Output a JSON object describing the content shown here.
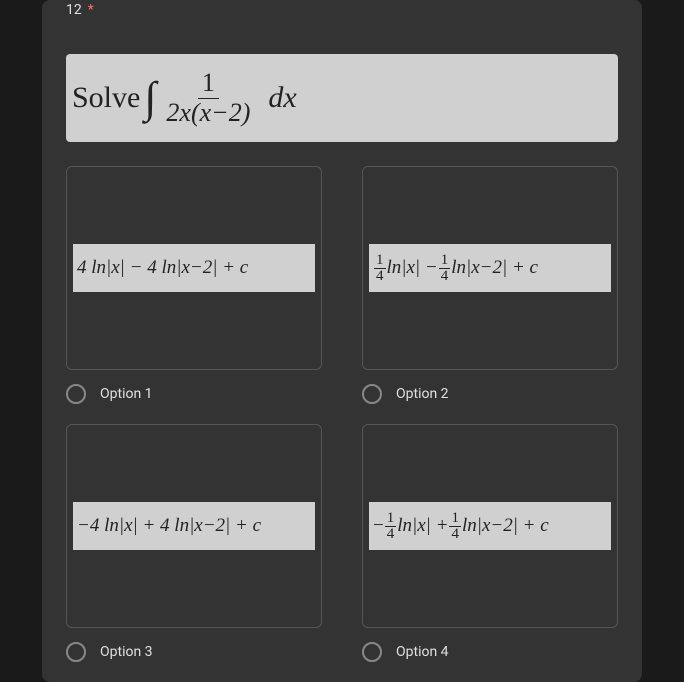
{
  "question": {
    "number": "12",
    "required_marker": "*",
    "prompt_prefix": "Solve",
    "integral": {
      "numerator": "1",
      "denominator": "2x(x−2)",
      "suffix": "dx"
    }
  },
  "options": [
    {
      "label": "Option 1",
      "formula_plain": "4 ln|x| − 4 ln|x−2| + c"
    },
    {
      "label": "Option 2",
      "formula_frac": {
        "a_sign": "",
        "a_num": "1",
        "a_den": "4",
        "mid": "ln|x| −",
        "b_num": "1",
        "b_den": "4",
        "tail": "ln|x−2| + c"
      }
    },
    {
      "label": "Option 3",
      "formula_plain": "−4 ln|x| + 4 ln|x−2| + c"
    },
    {
      "label": "Option 4",
      "formula_frac": {
        "a_sign": "−",
        "a_num": "1",
        "a_den": "4",
        "mid": "ln|x| +",
        "b_num": "1",
        "b_den": "4",
        "tail": "ln|x−2| + c"
      }
    }
  ],
  "chart_data": {
    "type": "table",
    "title": "Multiple choice integral question",
    "question": "Solve ∫ 1 / (2x(x−2)) dx",
    "choices": [
      "4 ln|x| − 4 ln|x−2| + c",
      "(1/4) ln|x| − (1/4) ln|x−2| + c",
      "−4 ln|x| + 4 ln|x−2| + c",
      "−(1/4) ln|x| + (1/4) ln|x−2| + c"
    ]
  }
}
